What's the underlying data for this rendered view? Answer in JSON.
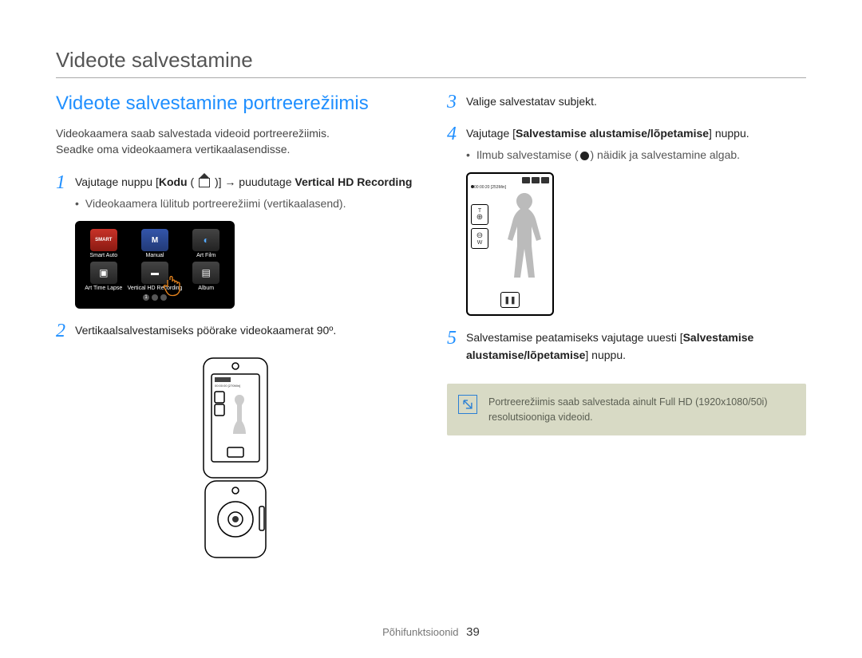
{
  "page_title": "Videote salvestamine",
  "section_title": "Videote salvestamine portreerežiimis",
  "intro_line1": "Videokaamera saab salvestada videoid portreerežiimis.",
  "intro_line2": "Seadke oma videokaamera vertikaalasendisse.",
  "steps": {
    "s1_pre": "Vajutage nuppu [",
    "s1_kodu": "Kodu",
    "s1_mid": " ( ",
    "s1_after_icon": " )] ",
    "s1_arrow": "→",
    "s1_puudutage": " puudutage ",
    "s1_vhd": "Vertical HD Recording",
    "s1_bullet": "Videokaamera lülitub portreerežiimi (vertikaalasend).",
    "s2": "Vertikaalsalvestamiseks pöörake videokaamerat 90º.",
    "s3": "Valige salvestatav subjekt.",
    "s4_pre": "Vajutage [",
    "s4_bold": "Salvestamise alustamise/lõpetamise",
    "s4_post": "] nuppu.",
    "s4_bullet_pre": "Ilmub salvestamise (",
    "s4_bullet_post": ") näidik ja salvestamine algab.",
    "s5_pre": "Salvestamise peatamiseks vajutage uuesti [",
    "s5_bold": "Salvestamise alustamise/lõpetamise",
    "s5_post": "] nuppu."
  },
  "home_icons": {
    "i1": "Smart Auto",
    "i2": "Manual",
    "i3": "Art Film",
    "i4": "Art Time Lapse",
    "i5": "Vertical HD Recording",
    "i6": "Album",
    "pg1": "1"
  },
  "portrait_screen": {
    "time": "00:00:20 [253Min]",
    "zoom_in": "T",
    "zoom_in_sym": "⊕",
    "zoom_out_sym": "⊖",
    "zoom_out": "W",
    "pause": "❚❚"
  },
  "note_text": "Portreerežiimis saab salvestada ainult Full HD (1920x1080/50i) resolutsiooniga videoid.",
  "footer_label": "Põhifunktsioonid",
  "footer_page": "39"
}
